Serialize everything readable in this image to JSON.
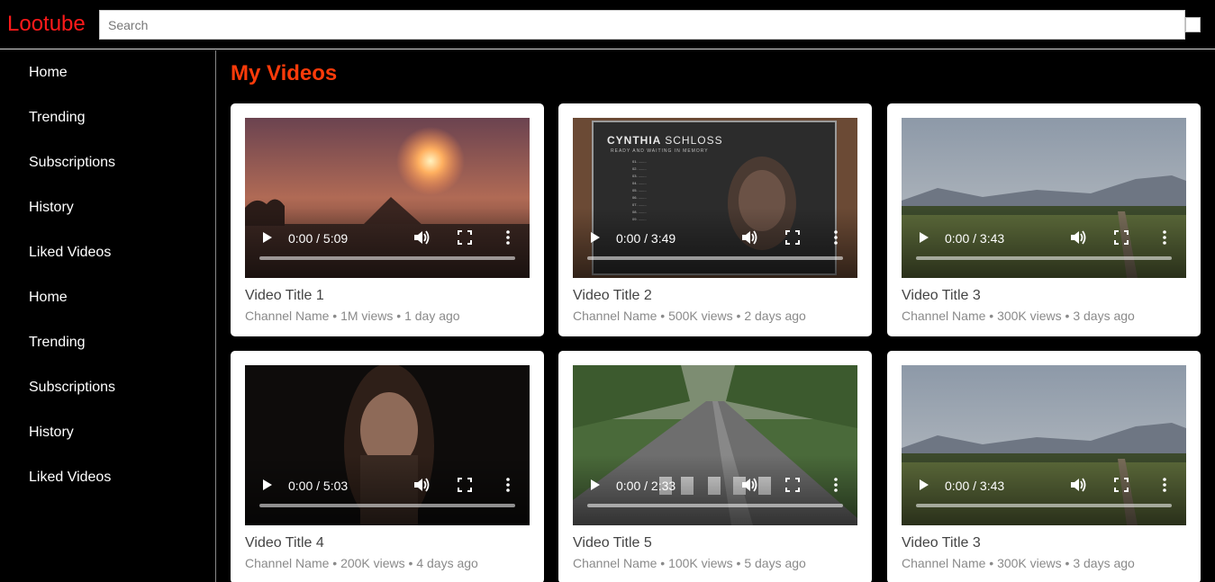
{
  "header": {
    "logo": "Lootube",
    "search_placeholder": "Search"
  },
  "sidebar": {
    "items": [
      {
        "label": "Home"
      },
      {
        "label": "Trending"
      },
      {
        "label": "Subscriptions"
      },
      {
        "label": "History"
      },
      {
        "label": "Liked Videos"
      },
      {
        "label": "Home"
      },
      {
        "label": "Trending"
      },
      {
        "label": "Subscriptions"
      },
      {
        "label": "History"
      },
      {
        "label": "Liked Videos"
      }
    ]
  },
  "main": {
    "title": "My Videos",
    "videos": [
      {
        "title": "Video Title 1",
        "meta": "Channel Name • 1M views • 1 day ago",
        "time": "0:00 / 5:09",
        "thumb": "sunset-pyramid",
        "progress": 0
      },
      {
        "title": "Video Title 2",
        "meta": "Channel Name • 500K views • 2 days ago",
        "time": "0:00 / 3:49",
        "thumb": "billboard-cynthia-schloss",
        "progress": 0
      },
      {
        "title": "Video Title 3",
        "meta": "Channel Name • 300K views • 3 days ago",
        "time": "0:00 / 3:43",
        "thumb": "hazy-mountain-field",
        "progress": 0
      },
      {
        "title": "Video Title 4",
        "meta": "Channel Name • 200K views • 4 days ago",
        "time": "0:00 / 5:03",
        "thumb": "woman-portrait-dark",
        "progress": 0
      },
      {
        "title": "Video Title 5",
        "meta": "Channel Name • 100K views • 5 days ago",
        "time": "0:00 / 2:33",
        "thumb": "rural-road",
        "progress": 0
      },
      {
        "title": "Video Title 3",
        "meta": "Channel Name • 300K views • 3 days ago",
        "time": "0:00 / 3:43",
        "thumb": "hazy-mountain-field",
        "progress": 0
      }
    ]
  },
  "billboard": {
    "name_first": "CYNTHIA",
    "name_last": "SCHLOSS",
    "subtitle": "READY AND WAITING IN MEMORY"
  },
  "colors": {
    "logo": "#ff1a1a",
    "page_title": "#ff3b0a",
    "background": "#000000",
    "card": "#ffffff"
  }
}
